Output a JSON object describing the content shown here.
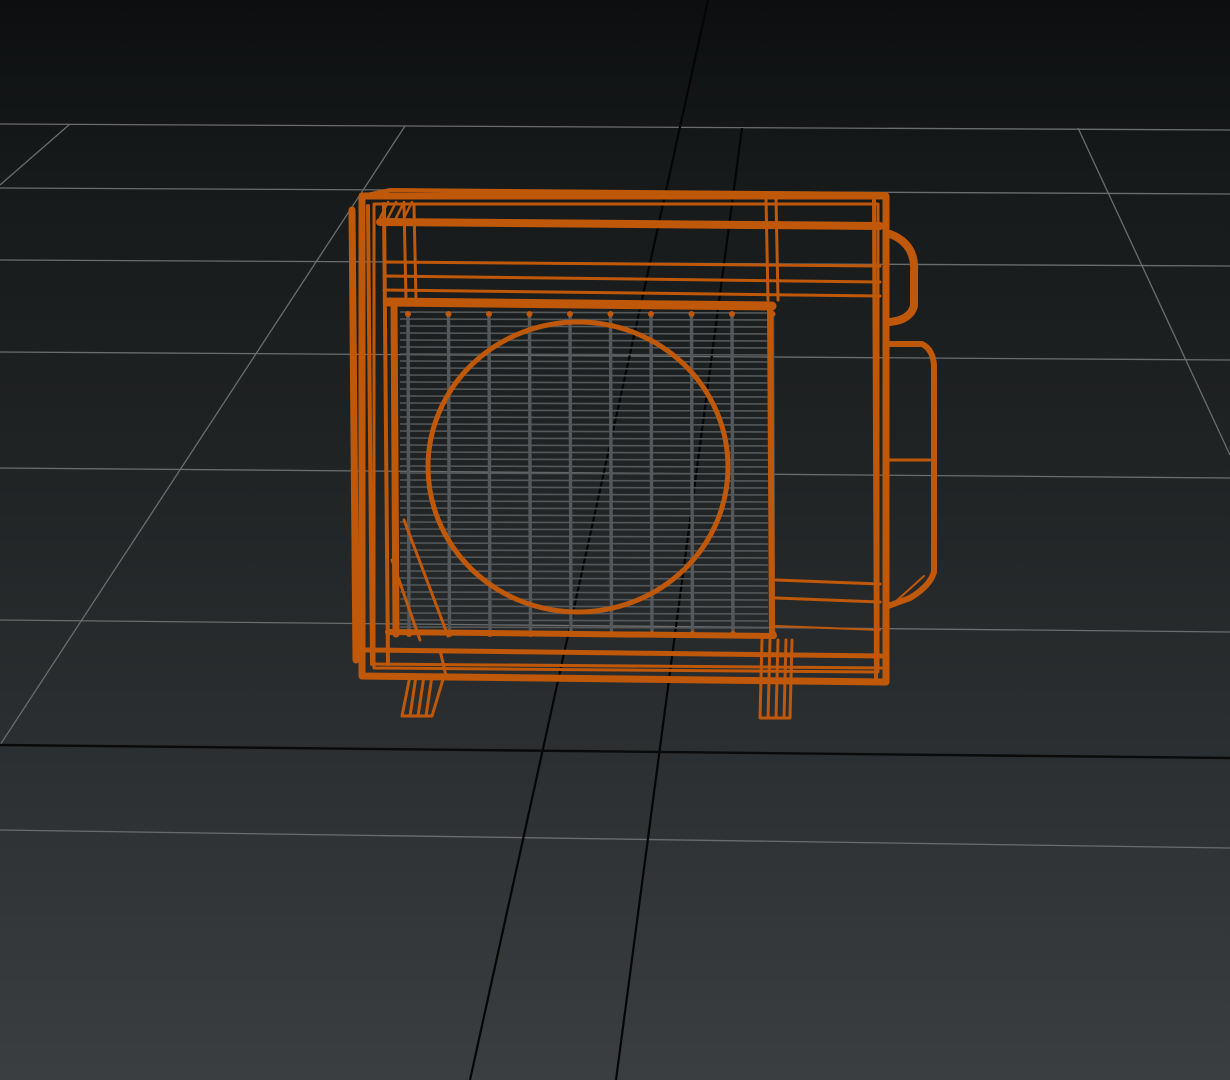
{
  "viewport": {
    "wire_color": "#c0580a",
    "grille_color": "#55585a",
    "grid_color": "#6a6c6e",
    "axis_color": "#050505",
    "background_top": "#0c0e0f",
    "background_bottom": "#3b3e40"
  },
  "model": {
    "icon": "air-conditioner-outdoor-unit-wireframe",
    "display_mode": "wireframe",
    "selected": true
  }
}
